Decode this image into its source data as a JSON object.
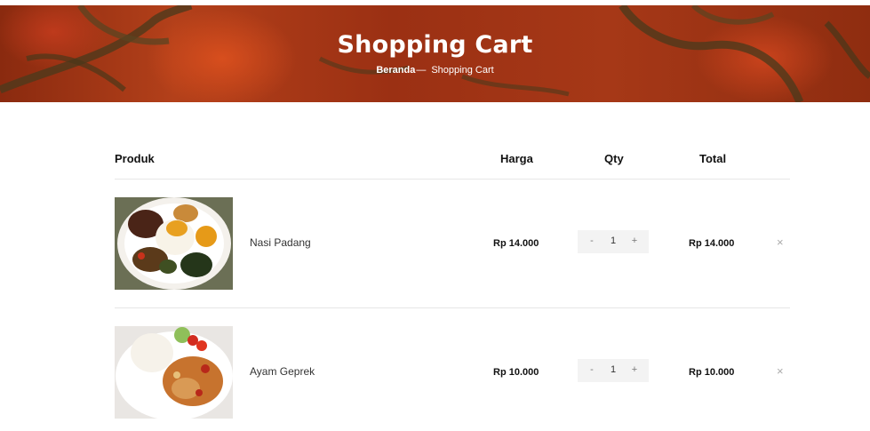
{
  "banner": {
    "title": "Shopping Cart",
    "breadcrumb": {
      "home": "Beranda",
      "separator": "—",
      "current": "Shopping Cart"
    }
  },
  "table": {
    "headers": {
      "product": "Produk",
      "price": "Harga",
      "qty": "Qty",
      "total": "Total"
    },
    "rows": [
      {
        "name": "Nasi Padang",
        "price": "Rp 14.000",
        "qty": "1",
        "total": "Rp 14.000",
        "minus": "-",
        "plus": "+",
        "remove": "×",
        "image": "nasi-padang-photo"
      },
      {
        "name": "Ayam Geprek",
        "price": "Rp 10.000",
        "qty": "1",
        "total": "Rp 10.000",
        "minus": "-",
        "plus": "+",
        "remove": "×",
        "image": "ayam-geprek-photo"
      }
    ]
  },
  "colors": {
    "banner": "#9b3013",
    "qty_bg": "#f3f3f3",
    "divider": "#e6e6e6"
  }
}
